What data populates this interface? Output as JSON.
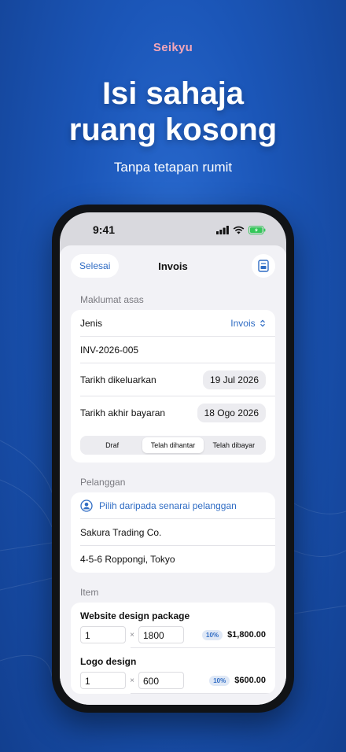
{
  "promo": {
    "brand": "Seikyu",
    "headline_line1": "Isi sahaja",
    "headline_line2": "ruang kosong",
    "subheadline": "Tanpa tetapan rumit"
  },
  "status_bar": {
    "time": "9:41",
    "icons": [
      "signal-icon",
      "wifi-icon",
      "battery-icon"
    ],
    "battery_color": "#34c759"
  },
  "nav": {
    "done_label": "Selesai",
    "title": "Invois",
    "right_icon": "document-icon"
  },
  "basic_info": {
    "section_label": "Maklumat asas",
    "type_label": "Jenis",
    "type_value": "Invois",
    "invoice_number": "INV-2026-005",
    "issue_date_label": "Tarikh dikeluarkan",
    "issue_date": "19 Jul 2026",
    "due_date_label": "Tarikh akhir bayaran",
    "due_date": "18 Ogo 2026",
    "status_options": [
      "Draf",
      "Telah dihantar",
      "Telah dibayar"
    ],
    "status_selected": "Telah dihantar"
  },
  "customer": {
    "section_label": "Pelanggan",
    "pick_label": "Pilih daripada senarai pelanggan",
    "name": "Sakura Trading Co.",
    "address": "4-5-6 Roppongi, Tokyo"
  },
  "items": {
    "section_label": "Item",
    "list": [
      {
        "name": "Website design package",
        "qty": "1",
        "price": "1800",
        "tax": "10%",
        "total": "$1,800.00"
      },
      {
        "name": "Logo design",
        "qty": "1",
        "price": "600",
        "tax": "10%",
        "total": "$600.00"
      }
    ]
  },
  "colors": {
    "accent": "#2f6cc4",
    "brand_pink": "#f3a6b8",
    "background": "#1b56b8"
  }
}
